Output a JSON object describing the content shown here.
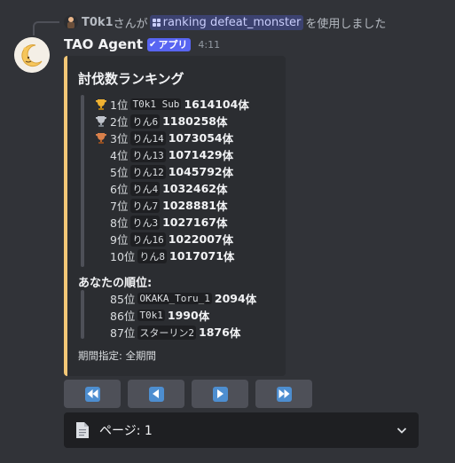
{
  "command_line": {
    "user": "T0k1",
    "suffix_san": "さんが",
    "command": "ranking defeat_monster",
    "suffix_used": "を使用しました"
  },
  "message": {
    "bot_name": "TAO Agent",
    "badge": "アプリ",
    "time": "4:11"
  },
  "embed": {
    "accent_color": "#f3c776",
    "title": "討伐数ランキング",
    "rankings": [
      {
        "rank": "1位",
        "name": "T0k1 Sub",
        "count": "1614104",
        "unit": "体",
        "trophy": "gold-trophy-icon"
      },
      {
        "rank": "2位",
        "name": "りん6",
        "count": "1180258",
        "unit": "体",
        "trophy": "silver-trophy-icon"
      },
      {
        "rank": "3位",
        "name": "りん14",
        "count": "1073054",
        "unit": "体",
        "trophy": "bronze-trophy-icon"
      },
      {
        "rank": "4位",
        "name": "りん13",
        "count": "1071429",
        "unit": "体"
      },
      {
        "rank": "5位",
        "name": "りん12",
        "count": "1045792",
        "unit": "体"
      },
      {
        "rank": "6位",
        "name": "りん4",
        "count": "1032462",
        "unit": "体"
      },
      {
        "rank": "7位",
        "name": "りん7",
        "count": "1028881",
        "unit": "体"
      },
      {
        "rank": "8位",
        "name": "りん3",
        "count": "1027167",
        "unit": "体"
      },
      {
        "rank": "9位",
        "name": "りん16",
        "count": "1022007",
        "unit": "体"
      },
      {
        "rank": "10位",
        "name": "りん8",
        "count": "1017071",
        "unit": "体"
      }
    ],
    "your_rank_title": "あなたの順位:",
    "your_rank": [
      {
        "rank": "85位",
        "name": "OKAKA_Toru_1",
        "count": "2094",
        "unit": "体"
      },
      {
        "rank": "86位",
        "name": "T0k1",
        "count": "1990",
        "unit": "体"
      },
      {
        "rank": "87位",
        "name": "スターリン2",
        "count": "1876",
        "unit": "体"
      }
    ],
    "footer": "期間指定: 全期間"
  },
  "buttons": [
    {
      "icon": "first-page-icon"
    },
    {
      "icon": "previous-page-icon"
    },
    {
      "icon": "next-page-icon"
    },
    {
      "icon": "last-page-icon"
    }
  ],
  "select": {
    "icon": "page-document-icon",
    "label": "ページ: 1"
  }
}
